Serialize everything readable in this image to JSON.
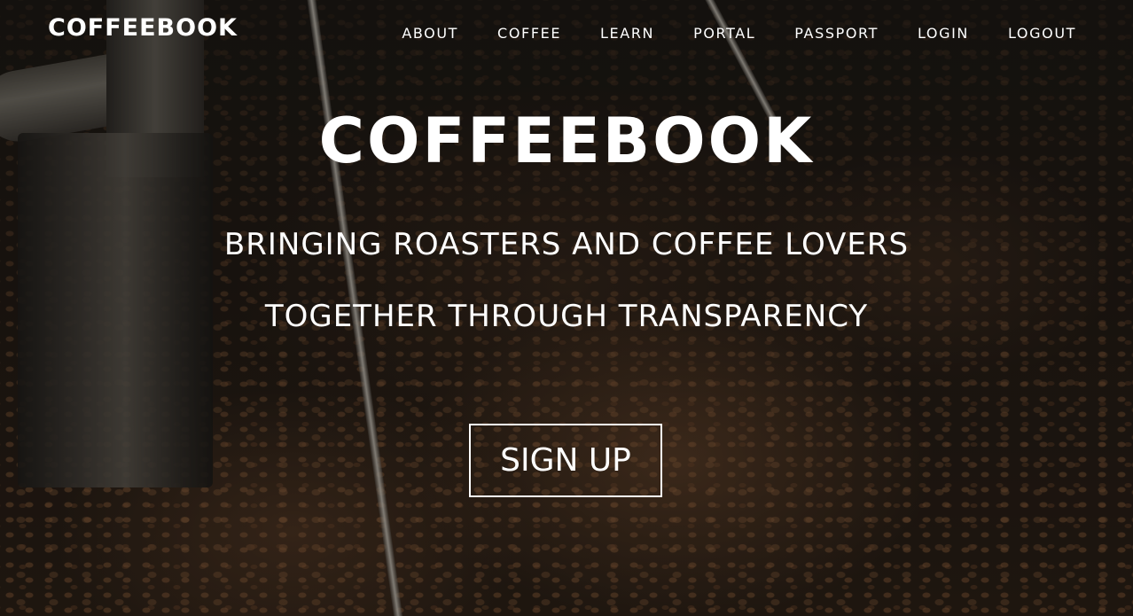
{
  "brand": "COFFEEBOOK",
  "nav": {
    "items": [
      "ABOUT",
      "COFFEE",
      "LEARN",
      "PORTAL",
      "PASSPORT",
      "LOGIN",
      "LOGOUT"
    ]
  },
  "hero": {
    "title": "COFFEEBOOK",
    "tagline_line1": "BRINGING ROASTERS AND COFFEE LOVERS",
    "tagline_line2": "TOGETHER THROUGH TRANSPARENCY",
    "signup_label": "SIGN UP",
    "background_description_icon": "coffee-roaster-beans-background"
  },
  "colors": {
    "text": "#ffffff",
    "background_dark": "#1c1814"
  }
}
